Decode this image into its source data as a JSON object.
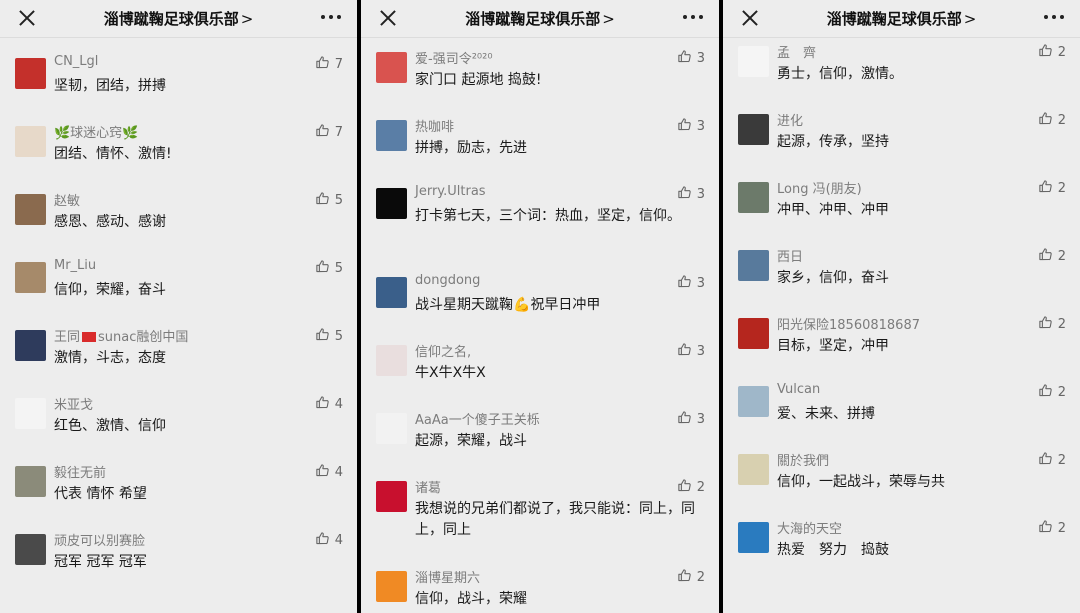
{
  "header": {
    "title": "淄博蹴鞠足球俱乐部",
    "chevron": ">"
  },
  "colors": {
    "background": "#ededed",
    "name": "#7c7c7c",
    "text": "#1a1a1a"
  },
  "panels": [
    {
      "items": [
        {
          "name": "CN_Lgl",
          "text": "坚韧，团结，拼搏",
          "likes": "7",
          "avatar_color": "#c4302b"
        },
        {
          "name": "🌿球迷心窍🌿",
          "text": "团结、情怀、激情!",
          "likes": "7",
          "avatar_color": "#e7d9c9"
        },
        {
          "name": "赵敏",
          "text": "感恩、感动、感谢",
          "likes": "5",
          "avatar_color": "#8a6a4e"
        },
        {
          "name": "Mr_Liu",
          "text": "信仰，荣耀，奋斗",
          "likes": "5",
          "avatar_color": "#a68a6a"
        },
        {
          "name": "王同",
          "name_suffix": "sunac融创中国",
          "text": "激情，斗志，态度",
          "likes": "5",
          "avatar_color": "#2e3b5c"
        },
        {
          "name": "米亚戈",
          "text": "红色、激情、信仰",
          "likes": "4",
          "avatar_color": "#f4f4f4"
        },
        {
          "name": "毅往无前",
          "text": "代表 情怀 希望",
          "likes": "4",
          "avatar_color": "#8b8b7a"
        },
        {
          "name": "顽皮可以别赛脸",
          "text": "冠军 冠军 冠军",
          "likes": "4",
          "avatar_color": "#4a4a4a"
        }
      ]
    },
    {
      "items": [
        {
          "name": "爱-强司令²⁰²⁰",
          "text": "家门口 起源地 捣鼓!",
          "likes": "3",
          "avatar_color": "#d9534f"
        },
        {
          "name": "热咖啡",
          "text": "拼搏，励志，先进",
          "likes": "3",
          "avatar_color": "#5a7ea6"
        },
        {
          "name": "Jerry.Ultras",
          "text": "打卡第七天，三个词：热血，坚定，信仰。",
          "likes": "3",
          "avatar_color": "#0a0a0a"
        },
        {
          "name": "dongdong",
          "text_before": "战斗星期天蹴鞠",
          "text_emoji": "💪",
          "text_after": "祝早日冲甲",
          "likes": "3",
          "avatar_color": "#3a5f8a"
        },
        {
          "name": "信仰之名,",
          "text": "牛X牛X牛X",
          "likes": "3",
          "avatar_color": "#e9dede"
        },
        {
          "name": "AaAa一个傻子王关栎",
          "text": "起源，荣耀，战斗",
          "likes": "3",
          "avatar_color": "#f2f2f2"
        },
        {
          "name": "诸葛",
          "text": "我想说的兄弟们都说了，我只能说：同上，同上，同上",
          "likes": "2",
          "avatar_color": "#c8102e"
        },
        {
          "name": "淄博星期六",
          "text": "信仰，战斗，荣耀",
          "likes": "2",
          "avatar_color": "#f08a24"
        }
      ]
    },
    {
      "items": [
        {
          "name": "孟　齊",
          "text": "勇士，信仰，激情。",
          "likes": "2",
          "avatar_color": "#f5f5f5"
        },
        {
          "name": "进化",
          "text": "起源，传承，坚持",
          "likes": "2",
          "avatar_color": "#3a3a3a"
        },
        {
          "name": "Long 冯(朋友)",
          "text": "冲甲、冲甲、冲甲",
          "likes": "2",
          "avatar_color": "#6c7a6a"
        },
        {
          "name": "西日",
          "text": "家乡，信仰，奋斗",
          "likes": "2",
          "avatar_color": "#587a9c"
        },
        {
          "name": "阳光保险18560818687",
          "text": "目标，坚定，冲甲",
          "likes": "2",
          "avatar_color": "#b5261e"
        },
        {
          "name": "Vulcan",
          "text": "爱、未来、拼搏",
          "likes": "2",
          "avatar_color": "#9fb7c9"
        },
        {
          "name": "關於我們",
          "text": "信仰，一起战斗，荣辱与共",
          "likes": "2",
          "avatar_color": "#d8d0b0"
        },
        {
          "name": "大海的天空",
          "text": "热爱　努力　捣鼓",
          "likes": "2",
          "avatar_color": "#2a7bbf"
        }
      ]
    }
  ]
}
